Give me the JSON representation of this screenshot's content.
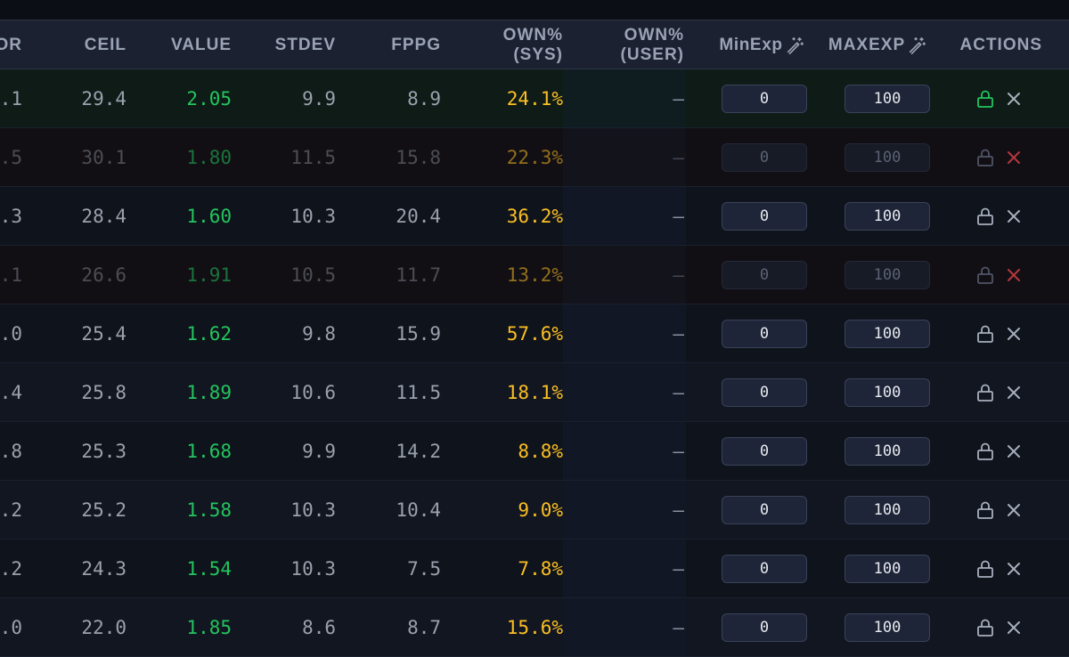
{
  "columns": {
    "floor": "OR",
    "ceil": "CEIL",
    "value": "VALUE",
    "stdev": "STDEV",
    "fppg": "FPPG",
    "own_sys": [
      "OWN%",
      "(SYS)"
    ],
    "own_user": [
      "OWN%",
      "(USER)"
    ],
    "min_exp": "MinExp",
    "max_exp": "MAXEXP",
    "actions": "ACTIONS"
  },
  "icons": {
    "min_exp_icon": "magic-wand-icon",
    "max_exp_icon": "magic-wand-icon",
    "lock": "lock-icon",
    "remove": "close-icon"
  },
  "colors": {
    "value": "#22c55e",
    "own": "#fbbf24",
    "locked_icon": "#22c55e",
    "excluded_icon": "#ef4444"
  },
  "rows": [
    {
      "floor": ".1",
      "ceil": "29.4",
      "value": "2.05",
      "stdev": "9.9",
      "fppg": "8.9",
      "own_sys": "24.1%",
      "own_user": "—",
      "min_exp": "0",
      "max_exp": "100",
      "state": "locked"
    },
    {
      "floor": ".5",
      "ceil": "30.1",
      "value": "1.80",
      "stdev": "11.5",
      "fppg": "15.8",
      "own_sys": "22.3%",
      "own_user": "—",
      "min_exp": "0",
      "max_exp": "100",
      "state": "excluded"
    },
    {
      "floor": ".3",
      "ceil": "28.4",
      "value": "1.60",
      "stdev": "10.3",
      "fppg": "20.4",
      "own_sys": "36.2%",
      "own_user": "—",
      "min_exp": "0",
      "max_exp": "100",
      "state": "normal"
    },
    {
      "floor": ".1",
      "ceil": "26.6",
      "value": "1.91",
      "stdev": "10.5",
      "fppg": "11.7",
      "own_sys": "13.2%",
      "own_user": "—",
      "min_exp": "0",
      "max_exp": "100",
      "state": "excluded"
    },
    {
      "floor": ".0",
      "ceil": "25.4",
      "value": "1.62",
      "stdev": "9.8",
      "fppg": "15.9",
      "own_sys": "57.6%",
      "own_user": "—",
      "min_exp": "0",
      "max_exp": "100",
      "state": "normal"
    },
    {
      "floor": ".4",
      "ceil": "25.8",
      "value": "1.89",
      "stdev": "10.6",
      "fppg": "11.5",
      "own_sys": "18.1%",
      "own_user": "—",
      "min_exp": "0",
      "max_exp": "100",
      "state": "normal"
    },
    {
      "floor": ".8",
      "ceil": "25.3",
      "value": "1.68",
      "stdev": "9.9",
      "fppg": "14.2",
      "own_sys": "8.8%",
      "own_user": "—",
      "min_exp": "0",
      "max_exp": "100",
      "state": "normal"
    },
    {
      "floor": ".2",
      "ceil": "25.2",
      "value": "1.58",
      "stdev": "10.3",
      "fppg": "10.4",
      "own_sys": "9.0%",
      "own_user": "—",
      "min_exp": "0",
      "max_exp": "100",
      "state": "normal"
    },
    {
      "floor": ".2",
      "ceil": "24.3",
      "value": "1.54",
      "stdev": "10.3",
      "fppg": "7.5",
      "own_sys": "7.8%",
      "own_user": "—",
      "min_exp": "0",
      "max_exp": "100",
      "state": "normal"
    },
    {
      "floor": ".0",
      "ceil": "22.0",
      "value": "1.85",
      "stdev": "8.6",
      "fppg": "8.7",
      "own_sys": "15.6%",
      "own_user": "—",
      "min_exp": "0",
      "max_exp": "100",
      "state": "normal"
    }
  ]
}
